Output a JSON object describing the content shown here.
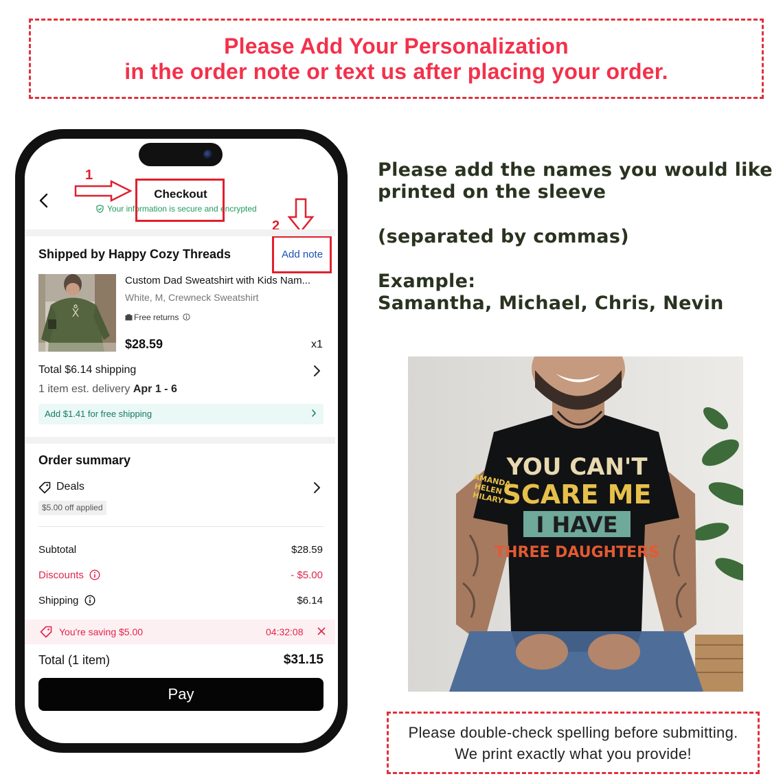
{
  "banner": {
    "line1": "Please Add Your Personalization",
    "line2": "in the order note or text us after placing your order."
  },
  "checkout": {
    "title": "Checkout",
    "secure_text": "Your information is secure and encrypted",
    "step1": "1",
    "step2": "2",
    "seller": "Shipped by Happy Cozy Threads",
    "add_note": "Add note",
    "product": {
      "title": "Custom Dad Sweatshirt with Kids Nam...",
      "variant": "White, M, Crewneck Sweatshirt",
      "free_returns": "Free returns",
      "price": "$28.59",
      "qty": "x1"
    },
    "shipping_total": "Total $6.14 shipping",
    "delivery_prefix": "1 item est. delivery ",
    "delivery_dates": "Apr 1 - 6",
    "free_shipping": "Add $1.41 for free shipping",
    "order_summary": "Order summary",
    "deals": "Deals",
    "deals_badge": "$5.00 off applied",
    "subtotal_label": "Subtotal",
    "subtotal_value": "$28.59",
    "discounts_label": "Discounts",
    "discounts_value": "- $5.00",
    "shipping_label": "Shipping",
    "shipping_value": "$6.14",
    "saving_text": "You're saving $5.00",
    "saving_timer": "04:32:08",
    "total_label": "Total (1 item)",
    "total_value": "$31.15",
    "pay": "Pay"
  },
  "instructions": {
    "line1": "Please add the names you would like",
    "line2": "printed on the sleeve",
    "line3": "(separated by commas)",
    "line4": "Example:",
    "line5": "Samantha, Michael, Chris, Nevin"
  },
  "shirt": {
    "line1": "YOU CAN'T",
    "line2": "SCARE ME",
    "line3": "I HAVE",
    "line4": "THREE DAUGHTERS",
    "sleeve": [
      "AMANDA",
      "HELEN",
      "HILARY"
    ]
  },
  "bottom_note": {
    "line1": "Please double-check spelling before submitting.",
    "line2": "We print exactly what you provide!"
  },
  "colors": {
    "banner_red": "#f3314b",
    "accent_red": "#e0202e",
    "link_blue": "#1a4fb5",
    "secure_green": "#1f9a5b",
    "instruction_text": "#2a3320"
  }
}
